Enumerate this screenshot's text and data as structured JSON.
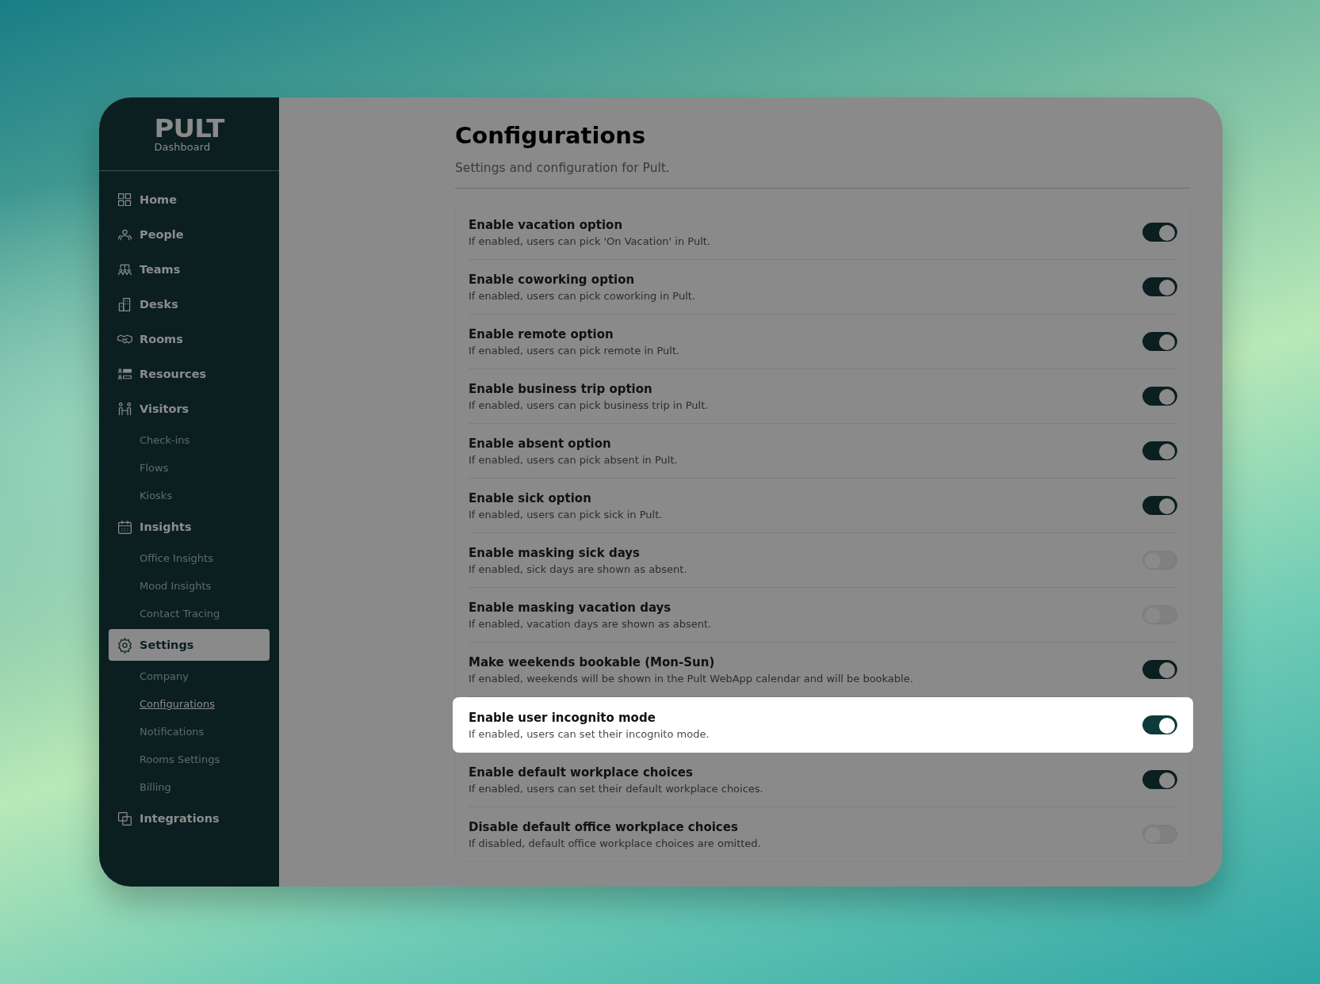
{
  "sidebar": {
    "logo": "PULT",
    "subtitle": "Dashboard",
    "items": [
      {
        "label": "Home",
        "selected": false
      },
      {
        "label": "People",
        "selected": false
      },
      {
        "label": "Teams",
        "selected": false
      },
      {
        "label": "Desks",
        "selected": false
      },
      {
        "label": "Rooms",
        "selected": false
      },
      {
        "label": "Resources",
        "selected": false
      },
      {
        "label": "Visitors",
        "selected": false,
        "children": [
          {
            "label": "Check-ins",
            "selected": false
          },
          {
            "label": "Flows",
            "selected": false
          },
          {
            "label": "Kiosks",
            "selected": false
          }
        ]
      },
      {
        "label": "Insights",
        "selected": false,
        "children": [
          {
            "label": "Office Insights",
            "selected": false
          },
          {
            "label": "Mood Insights",
            "selected": false
          },
          {
            "label": "Contact Tracing",
            "selected": false
          }
        ]
      },
      {
        "label": "Settings",
        "selected": true,
        "children": [
          {
            "label": "Company",
            "selected": false
          },
          {
            "label": "Configurations",
            "selected": true
          },
          {
            "label": "Notifications",
            "selected": false
          },
          {
            "label": "Rooms Settings",
            "selected": false
          },
          {
            "label": "Billing",
            "selected": false
          }
        ]
      },
      {
        "label": "Integrations",
        "selected": false
      }
    ]
  },
  "page": {
    "title": "Configurations",
    "subtitle": "Settings and configuration for Pult."
  },
  "settings": [
    {
      "title": "Enable vacation option",
      "description": "If enabled, users can pick 'On Vacation' in Pult.",
      "on": true,
      "highlighted": false
    },
    {
      "title": "Enable coworking option",
      "description": "If enabled, users can pick coworking in Pult.",
      "on": true,
      "highlighted": false
    },
    {
      "title": "Enable remote option",
      "description": "If enabled, users can pick remote in Pult.",
      "on": true,
      "highlighted": false
    },
    {
      "title": "Enable business trip option",
      "description": "If enabled, users can pick business trip in Pult.",
      "on": true,
      "highlighted": false
    },
    {
      "title": "Enable absent option",
      "description": "If enabled, users can pick absent in Pult.",
      "on": true,
      "highlighted": false
    },
    {
      "title": "Enable sick option",
      "description": "If enabled, users can pick sick in Pult.",
      "on": true,
      "highlighted": false
    },
    {
      "title": "Enable masking sick days",
      "description": "If enabled, sick days are shown as absent.",
      "on": false,
      "highlighted": false
    },
    {
      "title": "Enable masking vacation days",
      "description": "If enabled, vacation days are shown as absent.",
      "on": false,
      "highlighted": false
    },
    {
      "title": "Make weekends bookable (Mon-Sun)",
      "description": "If enabled, weekends will be shown in the Pult WebApp calendar and will be bookable.",
      "on": true,
      "highlighted": false
    },
    {
      "title": "Enable user incognito mode",
      "description": "If enabled, users can set their incognito mode.",
      "on": true,
      "highlighted": true
    },
    {
      "title": "Enable default workplace choices",
      "description": "If enabled, users can set their default workplace choices.",
      "on": true,
      "highlighted": false
    },
    {
      "title": "Disable default office workplace choices",
      "description": "If disabled, default office workplace choices are omitted.",
      "on": false,
      "highlighted": false
    }
  ]
}
